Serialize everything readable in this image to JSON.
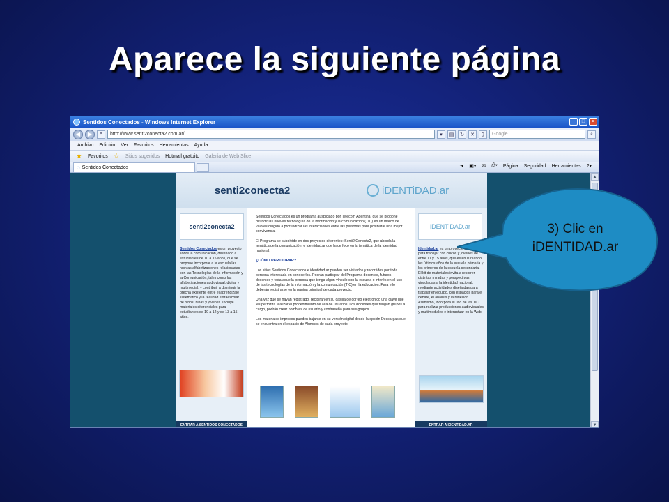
{
  "slide": {
    "title": "Aparece la siguiente página"
  },
  "browser": {
    "window_title": "Sentidos Conectados - Windows Internet Explorer",
    "url": "http://www.senti2conecta2.com.ar/",
    "search_placeholder": "Google",
    "menu": [
      "Archivo",
      "Edición",
      "Ver",
      "Favoritos",
      "Herramientas",
      "Ayuda"
    ],
    "favorites_label": "Favoritos",
    "favorites_items": [
      "Sitios sugeridos",
      "Hotmail gratuito",
      "Galería de Web Slice"
    ],
    "tab_title": "Sentidos Conectados",
    "command_bar": [
      "Página",
      "Seguridad",
      "Herramientas"
    ]
  },
  "webpage": {
    "header_brand": "senti2conecta2",
    "header_id_brand": "iDENTiDAD.ar",
    "left_logo": "senti2conecta2",
    "left_link": "Sentidos Conectados",
    "left_text": " es un proyecto sobre la comunicación, destinado a estudiantes de 10 a 15 años, que se propone incorporar a la escuela las nuevas alfabetizaciones relacionadas con las Tecnologías de la Información y la Comunicación, tales como las alfabetizaciones audiovisual, digital y multimedial, y contribuir a disminuir la brecha existente entre el aprendizaje sistemático y la realidad extraescolar de niños, niñas y jóvenes. Incluye materiales diferenciales para estudiantes de 10 a 12 y de 13 a 15 años.",
    "mid_p1": "Sentidos Conectados es un programa auspiciado por Telecom Agentina, que se propone difundir las nuevas tecnologías de la información y la comunicación (TIC) en un marco de valores dirigido a profundizar las interacciones entre las personas para posibilitar una mejor convivencia.",
    "mid_p2": "El Programa se subdivide en dos proyectos diferentes: Senti2 Conecta2, que aborda la temática de la comunicación, e identidad.ar que hace foco en la temática de la identidad nacional.",
    "mid_heading": "¿CÓMO PARTICIPAR?",
    "mid_p3": "Los sitios Sentidos Conectados e identidad.ar pueden ser visitados y recorridos por toda persona interesada en conocerlos. Podrán participar del Programa docentes, futuros docentes y toda aquella persona que tenga algún vínculo con la escuela o interés en el uso de las tecnologías de la información y la comunicación (TIC) en la educación. Para ello deberán registrarse en la página principal de cada proyecto.",
    "mid_p4": "Una vez que se hayan registrado, recibirán en su casilla de correo electrónico una clave que les permitirá realizar el procedimiento de alta de usuarios. Los docentes que tengan grupos a cargo, podrán crear nombres de usuario y contraseña para sus grupos.",
    "mid_p5": "Los materiales impresos pueden bajarse en su versión digital desde la opción Descargas que se encuentra en el espacio de Alumnos de cada proyecto.",
    "right_logo": "iDENTiDAD.ar",
    "right_link": "Identidad.ar",
    "right_text": " es un proyecto pensado para trabajar con chicos y jóvenes de entre 11 y 15 años, que estén cursando los últimos años de la escuela primaria y los primeros de la escuela secundaria. El kit de materiales invita a recorrer distintas miradas y perspectivas vinculadas a la identidad nacional, mediante actividades diseñadas para trabajar en equipo, con espacios para el debate, el análisis y la reflexión. Asimismo, incorpora el uso de las TIC para realizar producciones audiovisuales y multimediales e interactuar en la Web.",
    "left_footer": "ENTRAR A SENTIDOS CONECTADOS",
    "right_footer": "ENTRAR A IDENTIDAD.AR"
  },
  "callout": {
    "text": "3) Clic en iDENTIDAD.ar"
  }
}
